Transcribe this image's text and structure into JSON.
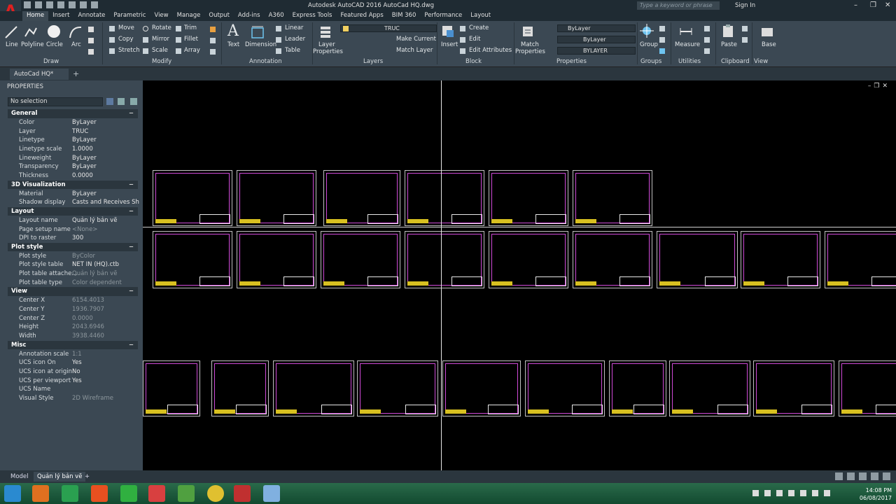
{
  "app": {
    "title": "Autodesk AutoCAD 2016   AutoCad HQ.dwg",
    "search_placeholder": "Type a keyword or phrase",
    "signin": "Sign In"
  },
  "ribbon_tabs": [
    "Home",
    "Insert",
    "Annotate",
    "Parametric",
    "View",
    "Manage",
    "Output",
    "Add-ins",
    "A360",
    "Express Tools",
    "Featured Apps",
    "BIM 360",
    "Performance",
    "Layout"
  ],
  "ribbon": {
    "draw": {
      "line": "Line",
      "polyline": "Polyline",
      "circle": "Circle",
      "arc": "Arc",
      "panel": "Draw"
    },
    "modify": {
      "move": "Move",
      "rotate": "Rotate",
      "trim": "Trim",
      "copy": "Copy",
      "mirror": "Mirror",
      "fillet": "Fillet",
      "stretch": "Stretch",
      "scale": "Scale",
      "array": "Array",
      "panel": "Modify"
    },
    "annotation": {
      "text": "Text",
      "dimension": "Dimension",
      "linear": "Linear",
      "leader": "Leader",
      "table": "Table",
      "panel": "Annotation"
    },
    "layers": {
      "layer_properties_1": "Layer",
      "layer_properties_2": "Properties",
      "current_layer": "TRUC",
      "make_current": "Make Current",
      "match_layer": "Match Layer",
      "panel": "Layers"
    },
    "block": {
      "insert": "Insert",
      "create": "Create",
      "edit": "Edit",
      "edit_attributes": "Edit Attributes",
      "panel": "Block"
    },
    "properties": {
      "match_1": "Match",
      "match_2": "Properties",
      "color": "ByLayer",
      "linetype": "ByLayer",
      "lineweight": "BYLAYER",
      "panel": "Properties"
    },
    "groups": {
      "group": "Group",
      "panel": "Groups"
    },
    "utilities": {
      "measure": "Measure",
      "panel": "Utilities"
    },
    "clipboard": {
      "paste": "Paste",
      "panel": "Clipboard"
    },
    "view": {
      "base": "Base",
      "panel": "View"
    }
  },
  "doc_tab": "AutoCad HQ*",
  "properties_panel": {
    "title": "PROPERTIES",
    "selection": "No selection",
    "sections": [
      {
        "name": "General",
        "rows": [
          [
            "Color",
            "ByLayer"
          ],
          [
            "Layer",
            "TRUC"
          ],
          [
            "Linetype",
            "ByLayer"
          ],
          [
            "Linetype scale",
            "1.0000"
          ],
          [
            "Lineweight",
            "ByLayer"
          ],
          [
            "Transparency",
            "ByLayer"
          ],
          [
            "Thickness",
            "0.0000"
          ]
        ]
      },
      {
        "name": "3D Visualization",
        "rows": [
          [
            "Material",
            "ByLayer"
          ],
          [
            "Shadow display",
            "Casts and Receives Sha..."
          ]
        ]
      },
      {
        "name": "Layout",
        "rows": [
          [
            "Layout name",
            "Quản lý bản vẽ"
          ],
          [
            "Page setup name",
            "<None>"
          ],
          [
            "DPI to raster",
            "300"
          ]
        ]
      },
      {
        "name": "Plot style",
        "rows": [
          [
            "Plot style",
            "ByColor"
          ],
          [
            "Plot style table",
            "NET IN (HQ).ctb"
          ],
          [
            "Plot table attache...",
            "Quản lý bản vẽ"
          ],
          [
            "Plot table type",
            "Color dependent"
          ]
        ]
      },
      {
        "name": "View",
        "rows": [
          [
            "Center X",
            "6154.4013"
          ],
          [
            "Center Y",
            "1936.7907"
          ],
          [
            "Center Z",
            "0.0000"
          ],
          [
            "Height",
            "2043.6946"
          ],
          [
            "Width",
            "3938.4460"
          ]
        ]
      },
      {
        "name": "Misc",
        "rows": [
          [
            "Annotation scale",
            "1:1"
          ],
          [
            "UCS icon On",
            "Yes"
          ],
          [
            "UCS icon at origin",
            "No"
          ],
          [
            "UCS per viewport",
            "Yes"
          ],
          [
            "UCS Name",
            ""
          ],
          [
            "Visual Style",
            "2D Wireframe"
          ]
        ]
      }
    ]
  },
  "layout_tabs": [
    "Model",
    "Quản lý bản vẽ"
  ],
  "clock": {
    "time": "14:08 PM",
    "date": "06/08/2017"
  }
}
